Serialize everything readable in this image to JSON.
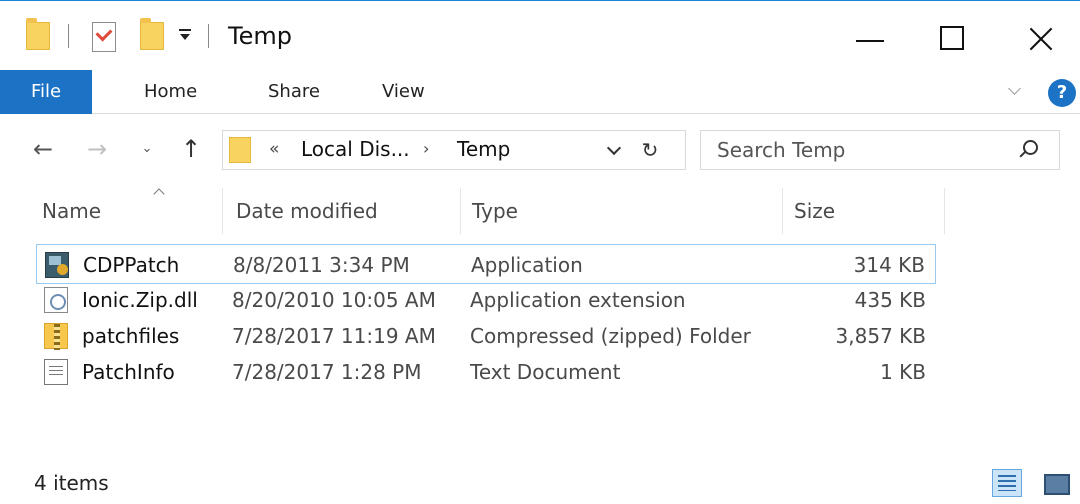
{
  "window": {
    "title": "Temp",
    "controls": [
      "minimize",
      "maximize",
      "close"
    ]
  },
  "quick_access": {
    "icons": [
      "folder-icon",
      "properties-icon",
      "new-folder-icon"
    ]
  },
  "ribbon": {
    "tabs": [
      {
        "label": "File",
        "active": true
      },
      {
        "label": "Home"
      },
      {
        "label": "Share"
      },
      {
        "label": "View"
      }
    ],
    "help_label": "?"
  },
  "nav": {
    "back": "←",
    "forward": "→",
    "recent": "⌄",
    "up": "↑",
    "address_prefix": "«",
    "address_parts": [
      "Local Dis...",
      "Temp"
    ],
    "address_separator": "›",
    "refresh": "↻",
    "search_placeholder": "Search Temp"
  },
  "columns": {
    "name": "Name",
    "date": "Date modified",
    "type": "Type",
    "size": "Size"
  },
  "files": [
    {
      "name": "CDPPatch",
      "date": "8/8/2011 3:34 PM",
      "type": "Application",
      "size": "314 KB",
      "icon": "application-icon"
    },
    {
      "name": "Ionic.Zip.dll",
      "date": "8/20/2010 10:05 AM",
      "type": "Application extension",
      "size": "435 KB",
      "icon": "dll-icon"
    },
    {
      "name": "patchfiles",
      "date": "7/28/2017 11:19 AM",
      "type": "Compressed (zipped) Folder",
      "size": "3,857 KB",
      "icon": "zip-folder-icon"
    },
    {
      "name": "PatchInfo",
      "date": "7/28/2017 1:28 PM",
      "type": "Text Document",
      "size": "1 KB",
      "icon": "text-document-icon"
    }
  ],
  "status": {
    "item_count": "4 items"
  },
  "colors": {
    "accent": "#1c72c4",
    "focus_border": "#99c9ef",
    "folder": "#f9d35f"
  }
}
